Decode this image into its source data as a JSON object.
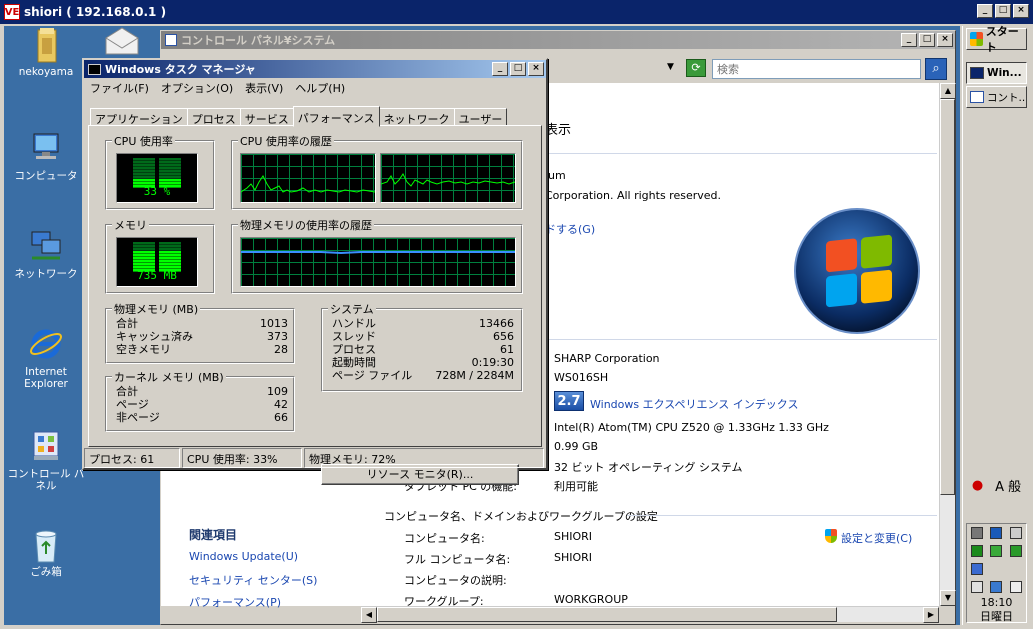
{
  "vnc": {
    "title": "shiori ( 192.168.0.1 )",
    "logo": "VE"
  },
  "desktop_icons": [
    {
      "label": "nekoyama",
      "icon": "folder-icon"
    },
    {
      "label": "コンピュータ",
      "icon": "computer-icon"
    },
    {
      "label": "ネットワーク",
      "icon": "network-icon"
    },
    {
      "label": "Internet Explorer",
      "icon": "internet-explorer-icon"
    },
    {
      "label": "コントロール パネル",
      "icon": "control-panel-icon"
    },
    {
      "label": "ごみ箱",
      "icon": "recycle-bin-icon"
    }
  ],
  "taskbar": {
    "start_label": "スタート",
    "items": [
      {
        "label": "Win..."
      },
      {
        "label": "コント..."
      }
    ],
    "tray_text": "A 般",
    "clock_time": "18:10",
    "clock_day": "日曜日"
  },
  "control_panel": {
    "title": "コントロール パネル¥システム",
    "search_placeholder": "検索",
    "heading_fragment": "表示",
    "edition_fragment": "ium",
    "copyright_fragment": "Corporation.  All rights reserved.",
    "upgrade_link_fragment": "ドする(G)",
    "manufacturer": "SHARP Corporation",
    "model": "WS016SH",
    "wei_score": "2.7",
    "wei_link": "Windows エクスペリエンス インデックス",
    "processor": "Intel(R) Atom(TM) CPU Z520   @ 1.33GHz   1.33 GHz",
    "memory": "0.99 GB",
    "system_type": "32 ビット オペレーティング システム",
    "tablet_label": "タブレット PC の機能:",
    "tablet_value": "利用可能",
    "section_header": "コンピュータ名、ドメインおよびワークグループの設定",
    "change_settings": "設定と変更(C)",
    "rows": [
      {
        "label": "コンピュータ名:",
        "value": "SHIORI"
      },
      {
        "label": "フル コンピュータ名:",
        "value": "SHIORI"
      },
      {
        "label": "コンピュータの説明:",
        "value": ""
      },
      {
        "label": "ワークグループ:",
        "value": "WORKGROUP"
      }
    ],
    "related": {
      "heading": "関連項目",
      "links": [
        "Windows Update(U)",
        "セキュリティ センター(S)",
        "パフォーマンス(P)"
      ]
    }
  },
  "task_manager": {
    "title": "Windows タスク マネージャ",
    "menu": [
      "ファイル(F)",
      "オプション(O)",
      "表示(V)",
      "ヘルプ(H)"
    ],
    "tabs": [
      "アプリケーション",
      "プロセス",
      "サービス",
      "パフォーマンス",
      "ネットワーク",
      "ユーザー"
    ],
    "active_tab": 3,
    "cpu": {
      "label": "CPU 使用率",
      "value": "33 %",
      "percent": 33
    },
    "cpu_history_label": "CPU 使用率の履歴",
    "memory": {
      "label": "メモリ",
      "value": "735 MB",
      "percent": 72
    },
    "memory_history_label": "物理メモリの使用率の履歴",
    "physical_memory": {
      "label": "物理メモリ (MB)",
      "rows": [
        {
          "k": "合計",
          "v": "1013"
        },
        {
          "k": "キャッシュ済み",
          "v": "373"
        },
        {
          "k": "空きメモリ",
          "v": "28"
        }
      ]
    },
    "kernel_memory": {
      "label": "カーネル メモリ (MB)",
      "rows": [
        {
          "k": "合計",
          "v": "109"
        },
        {
          "k": "ページ",
          "v": "42"
        },
        {
          "k": "非ページ",
          "v": "66"
        }
      ]
    },
    "system": {
      "label": "システム",
      "rows": [
        {
          "k": "ハンドル",
          "v": "13466"
        },
        {
          "k": "スレッド",
          "v": "656"
        },
        {
          "k": "プロセス",
          "v": "61"
        },
        {
          "k": "起動時間",
          "v": "0:19:30"
        },
        {
          "k": "ページ ファイル",
          "v": "728M / 2284M"
        }
      ]
    },
    "resource_monitor_button": "リソース モニタ(R)...",
    "status": {
      "processes": "プロセス: 61",
      "cpu": "CPU 使用率: 33%",
      "memory": "物理メモリ: 72%"
    }
  },
  "colors": {
    "titlebar": "#0a246a",
    "desktop": "#3a6ea5",
    "graph_green": "#00ff00",
    "graph_blue": "#3a8fff"
  }
}
